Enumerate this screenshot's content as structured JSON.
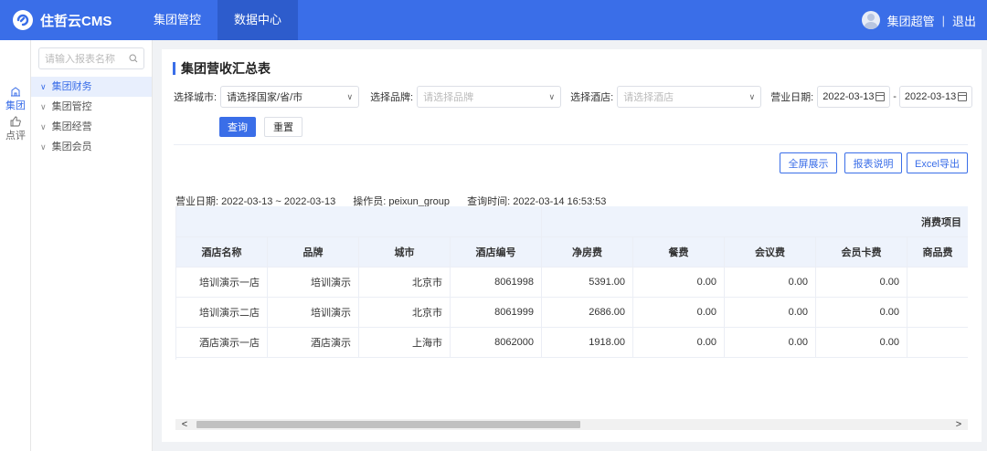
{
  "topbar": {
    "brand": "住哲云CMS",
    "nav": [
      "集团管控",
      "数据中心"
    ],
    "user": "集团超管",
    "separator": "|",
    "logout": "退出"
  },
  "rail": [
    {
      "label": "集团",
      "icon": "building-icon",
      "active": true
    },
    {
      "label": "点评",
      "icon": "thumbs-up-icon",
      "active": false
    }
  ],
  "sidebar": {
    "search_placeholder": "请输入报表名称",
    "items": [
      {
        "label": "集团财务",
        "active": true
      },
      {
        "label": "集团管控",
        "active": false
      },
      {
        "label": "集团经营",
        "active": false
      },
      {
        "label": "集团会员",
        "active": false
      }
    ]
  },
  "page": {
    "title": "集团营收汇总表",
    "filters": {
      "city_label": "选择城市:",
      "city_value": "请选择国家/省/市",
      "brand_label": "选择品牌:",
      "brand_placeholder": "请选择品牌",
      "hotel_label": "选择酒店:",
      "hotel_placeholder": "请选择酒店",
      "date_label": "营业日期:",
      "date_from": "2022-03-13",
      "date_sep": "-",
      "date_to": "2022-03-13"
    },
    "query_button": "查询",
    "reset_button": "重置",
    "fullscreen_button": "全屏展示",
    "report_info_button": "报表说明",
    "export_button": "Excel导出",
    "info": {
      "business_date": "营业日期: 2022-03-13 ~ 2022-03-13",
      "operator": "操作员: peixun_group",
      "query_time": "查询时间: 2022-03-14 16:53:53"
    }
  },
  "table": {
    "group_header": "消费项目",
    "columns": [
      "酒店名称",
      "品牌",
      "城市",
      "酒店编号",
      "净房费",
      "餐费",
      "会议费",
      "会员卡费",
      "商品费"
    ],
    "rows": [
      [
        "培训演示一店",
        "培训演示",
        "北京市",
        "8061998",
        "5391.00",
        "0.00",
        "0.00",
        "0.00",
        ""
      ],
      [
        "培训演示二店",
        "培训演示",
        "北京市",
        "8061999",
        "2686.00",
        "0.00",
        "0.00",
        "0.00",
        ""
      ],
      [
        "酒店演示一店",
        "酒店演示",
        "上海市",
        "8062000",
        "1918.00",
        "0.00",
        "0.00",
        "0.00",
        ""
      ]
    ]
  },
  "scrollbar": {
    "left_arrow": "<",
    "right_arrow": ">"
  },
  "colors": {
    "primary": "#3a6ee8",
    "header_bg": "#eef3fc"
  }
}
